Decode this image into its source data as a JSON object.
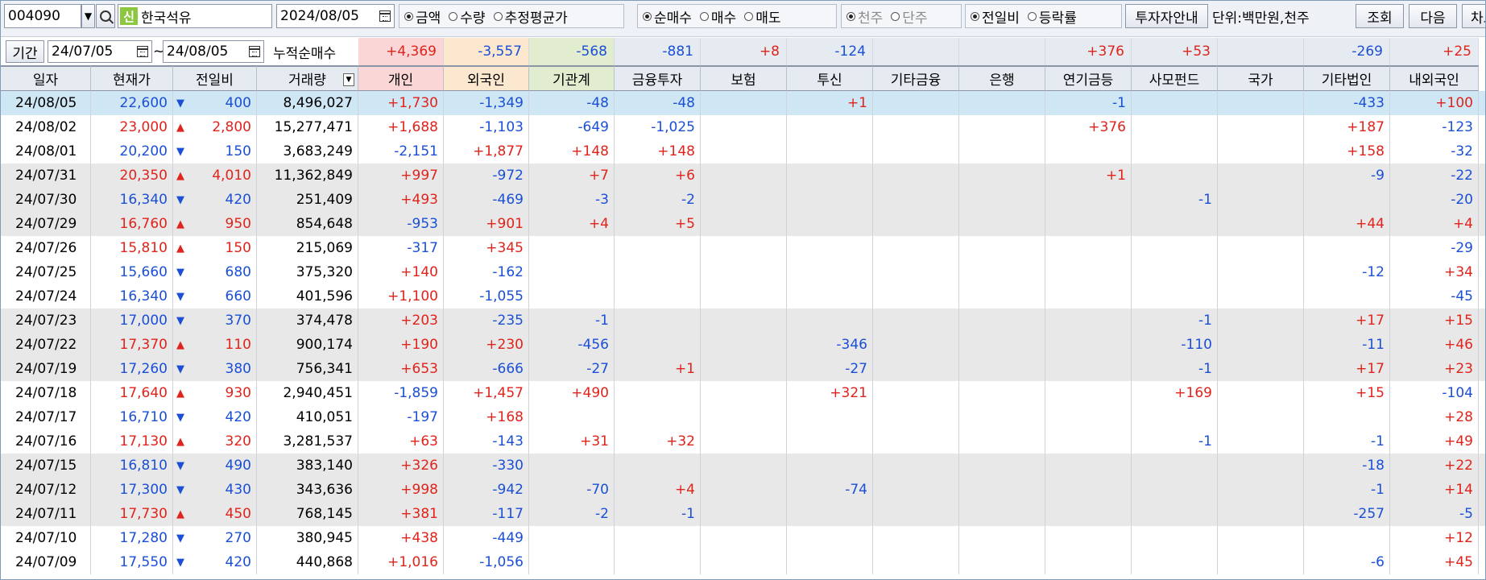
{
  "toolbar": {
    "code_value": "004090",
    "stock_badge": "신",
    "stock_name": "한국석유",
    "date_value": "2024/08/05",
    "amount_group": {
      "options": [
        "금액",
        "수량",
        "추정평균가"
      ],
      "selected": 0
    },
    "trade_group": {
      "options": [
        "순매수",
        "매수",
        "매도"
      ],
      "selected": 0
    },
    "unit_group": {
      "options": [
        "천주",
        "단주"
      ],
      "selected": 0
    },
    "compare_group": {
      "options": [
        "전일비",
        "등락률"
      ],
      "selected": 0
    },
    "investor_guide_label": "투자자안내",
    "unit_label": "단위:백만원,천주",
    "query_label": "조회",
    "next_label": "다음",
    "chart_label": "차트"
  },
  "period": {
    "label": "기간",
    "from": "24/07/05",
    "sep": "~",
    "to": "24/08/05",
    "cumulative_label": "누적순매수",
    "cumulative": [
      "+4,369",
      "-3,557",
      "-568",
      "-881",
      "+8",
      "-124",
      "",
      "",
      "+376",
      "+53",
      "",
      "-269",
      "+25"
    ]
  },
  "columns": [
    "일자",
    "현재가",
    "전일비",
    "거래량",
    "개인",
    "외국인",
    "기관계",
    "금융투자",
    "보험",
    "투신",
    "기타금융",
    "은행",
    "연기금등",
    "사모펀드",
    "국가",
    "기타법인",
    "내외국인"
  ],
  "colors": {
    "up": "#e0231b",
    "down": "#1a4fd6",
    "header_personal": "#fbd6d6",
    "header_foreign": "#fbe8cf",
    "header_inst": "#e2edcf",
    "header_base": "#e6ebf2",
    "row_gray": "#e8e8e8",
    "selected": "#cfe6f4"
  },
  "rows": [
    {
      "date": "24/08/05",
      "price": "22,600",
      "dir": "down",
      "chg": "400",
      "vol": "8,496,027",
      "v": [
        "+1,730",
        "-1,349",
        "-48",
        "-48",
        "",
        "+1",
        "",
        "",
        "-1",
        "",
        "",
        "-433",
        "+100"
      ]
    },
    {
      "date": "24/08/02",
      "price": "23,000",
      "dir": "up",
      "chg": "2,800",
      "vol": "15,277,471",
      "v": [
        "+1,688",
        "-1,103",
        "-649",
        "-1,025",
        "",
        "",
        "",
        "",
        "+376",
        "",
        "",
        "+187",
        "-123"
      ]
    },
    {
      "date": "24/08/01",
      "price": "20,200",
      "dir": "down",
      "chg": "150",
      "vol": "3,683,249",
      "v": [
        "-2,151",
        "+1,877",
        "+148",
        "+148",
        "",
        "",
        "",
        "",
        "",
        "",
        "",
        "+158",
        "-32"
      ]
    },
    {
      "date": "24/07/31",
      "price": "20,350",
      "dir": "up",
      "chg": "4,010",
      "vol": "11,362,849",
      "v": [
        "+997",
        "-972",
        "+7",
        "+6",
        "",
        "",
        "",
        "",
        "+1",
        "",
        "",
        "-9",
        "-22"
      ]
    },
    {
      "date": "24/07/30",
      "price": "16,340",
      "dir": "down",
      "chg": "420",
      "vol": "251,409",
      "v": [
        "+493",
        "-469",
        "-3",
        "-2",
        "",
        "",
        "",
        "",
        "",
        "-1",
        "",
        "",
        "-20"
      ]
    },
    {
      "date": "24/07/29",
      "price": "16,760",
      "dir": "up",
      "chg": "950",
      "vol": "854,648",
      "v": [
        "-953",
        "+901",
        "+4",
        "+5",
        "",
        "",
        "",
        "",
        "",
        "",
        "",
        "+44",
        "+4"
      ]
    },
    {
      "date": "24/07/26",
      "price": "15,810",
      "dir": "up",
      "chg": "150",
      "vol": "215,069",
      "v": [
        "-317",
        "+345",
        "",
        "",
        "",
        "",
        "",
        "",
        "",
        "",
        "",
        "",
        "-29"
      ]
    },
    {
      "date": "24/07/25",
      "price": "15,660",
      "dir": "down",
      "chg": "680",
      "vol": "375,320",
      "v": [
        "+140",
        "-162",
        "",
        "",
        "",
        "",
        "",
        "",
        "",
        "",
        "",
        "-12",
        "+34"
      ]
    },
    {
      "date": "24/07/24",
      "price": "16,340",
      "dir": "down",
      "chg": "660",
      "vol": "401,596",
      "v": [
        "+1,100",
        "-1,055",
        "",
        "",
        "",
        "",
        "",
        "",
        "",
        "",
        "",
        "",
        "-45"
      ]
    },
    {
      "date": "24/07/23",
      "price": "17,000",
      "dir": "down",
      "chg": "370",
      "vol": "374,478",
      "v": [
        "+203",
        "-235",
        "-1",
        "",
        "",
        "",
        "",
        "",
        "",
        "-1",
        "",
        "+17",
        "+15"
      ]
    },
    {
      "date": "24/07/22",
      "price": "17,370",
      "dir": "up",
      "chg": "110",
      "vol": "900,174",
      "v": [
        "+190",
        "+230",
        "-456",
        "",
        "",
        "-346",
        "",
        "",
        "",
        "-110",
        "",
        "-11",
        "+46"
      ]
    },
    {
      "date": "24/07/19",
      "price": "17,260",
      "dir": "down",
      "chg": "380",
      "vol": "756,341",
      "v": [
        "+653",
        "-666",
        "-27",
        "+1",
        "",
        "-27",
        "",
        "",
        "",
        "-1",
        "",
        "+17",
        "+23"
      ]
    },
    {
      "date": "24/07/18",
      "price": "17,640",
      "dir": "up",
      "chg": "930",
      "vol": "2,940,451",
      "v": [
        "-1,859",
        "+1,457",
        "+490",
        "",
        "",
        "+321",
        "",
        "",
        "",
        "+169",
        "",
        "+15",
        "-104"
      ]
    },
    {
      "date": "24/07/17",
      "price": "16,710",
      "dir": "down",
      "chg": "420",
      "vol": "410,051",
      "v": [
        "-197",
        "+168",
        "",
        "",
        "",
        "",
        "",
        "",
        "",
        "",
        "",
        "",
        "+28"
      ]
    },
    {
      "date": "24/07/16",
      "price": "17,130",
      "dir": "up",
      "chg": "320",
      "vol": "3,281,537",
      "v": [
        "+63",
        "-143",
        "+31",
        "+32",
        "",
        "",
        "",
        "",
        "",
        "-1",
        "",
        "-1",
        "+49"
      ]
    },
    {
      "date": "24/07/15",
      "price": "16,810",
      "dir": "down",
      "chg": "490",
      "vol": "383,140",
      "v": [
        "+326",
        "-330",
        "",
        "",
        "",
        "",
        "",
        "",
        "",
        "",
        "",
        "-18",
        "+22"
      ]
    },
    {
      "date": "24/07/12",
      "price": "17,300",
      "dir": "down",
      "chg": "430",
      "vol": "343,636",
      "v": [
        "+998",
        "-942",
        "-70",
        "+4",
        "",
        "-74",
        "",
        "",
        "",
        "",
        "",
        "-1",
        "+14"
      ]
    },
    {
      "date": "24/07/11",
      "price": "17,730",
      "dir": "up",
      "chg": "450",
      "vol": "768,145",
      "v": [
        "+381",
        "-117",
        "-2",
        "-1",
        "",
        "",
        "",
        "",
        "",
        "",
        "",
        "-257",
        "-5"
      ]
    },
    {
      "date": "24/07/10",
      "price": "17,280",
      "dir": "down",
      "chg": "270",
      "vol": "380,945",
      "v": [
        "+438",
        "-449",
        "",
        "",
        "",
        "",
        "",
        "",
        "",
        "",
        "",
        "",
        "+12"
      ]
    },
    {
      "date": "24/07/09",
      "price": "17,550",
      "dir": "down",
      "chg": "420",
      "vol": "440,868",
      "v": [
        "+1,016",
        "-1,056",
        "",
        "",
        "",
        "",
        "",
        "",
        "",
        "",
        "",
        "-6",
        "+45"
      ]
    }
  ]
}
